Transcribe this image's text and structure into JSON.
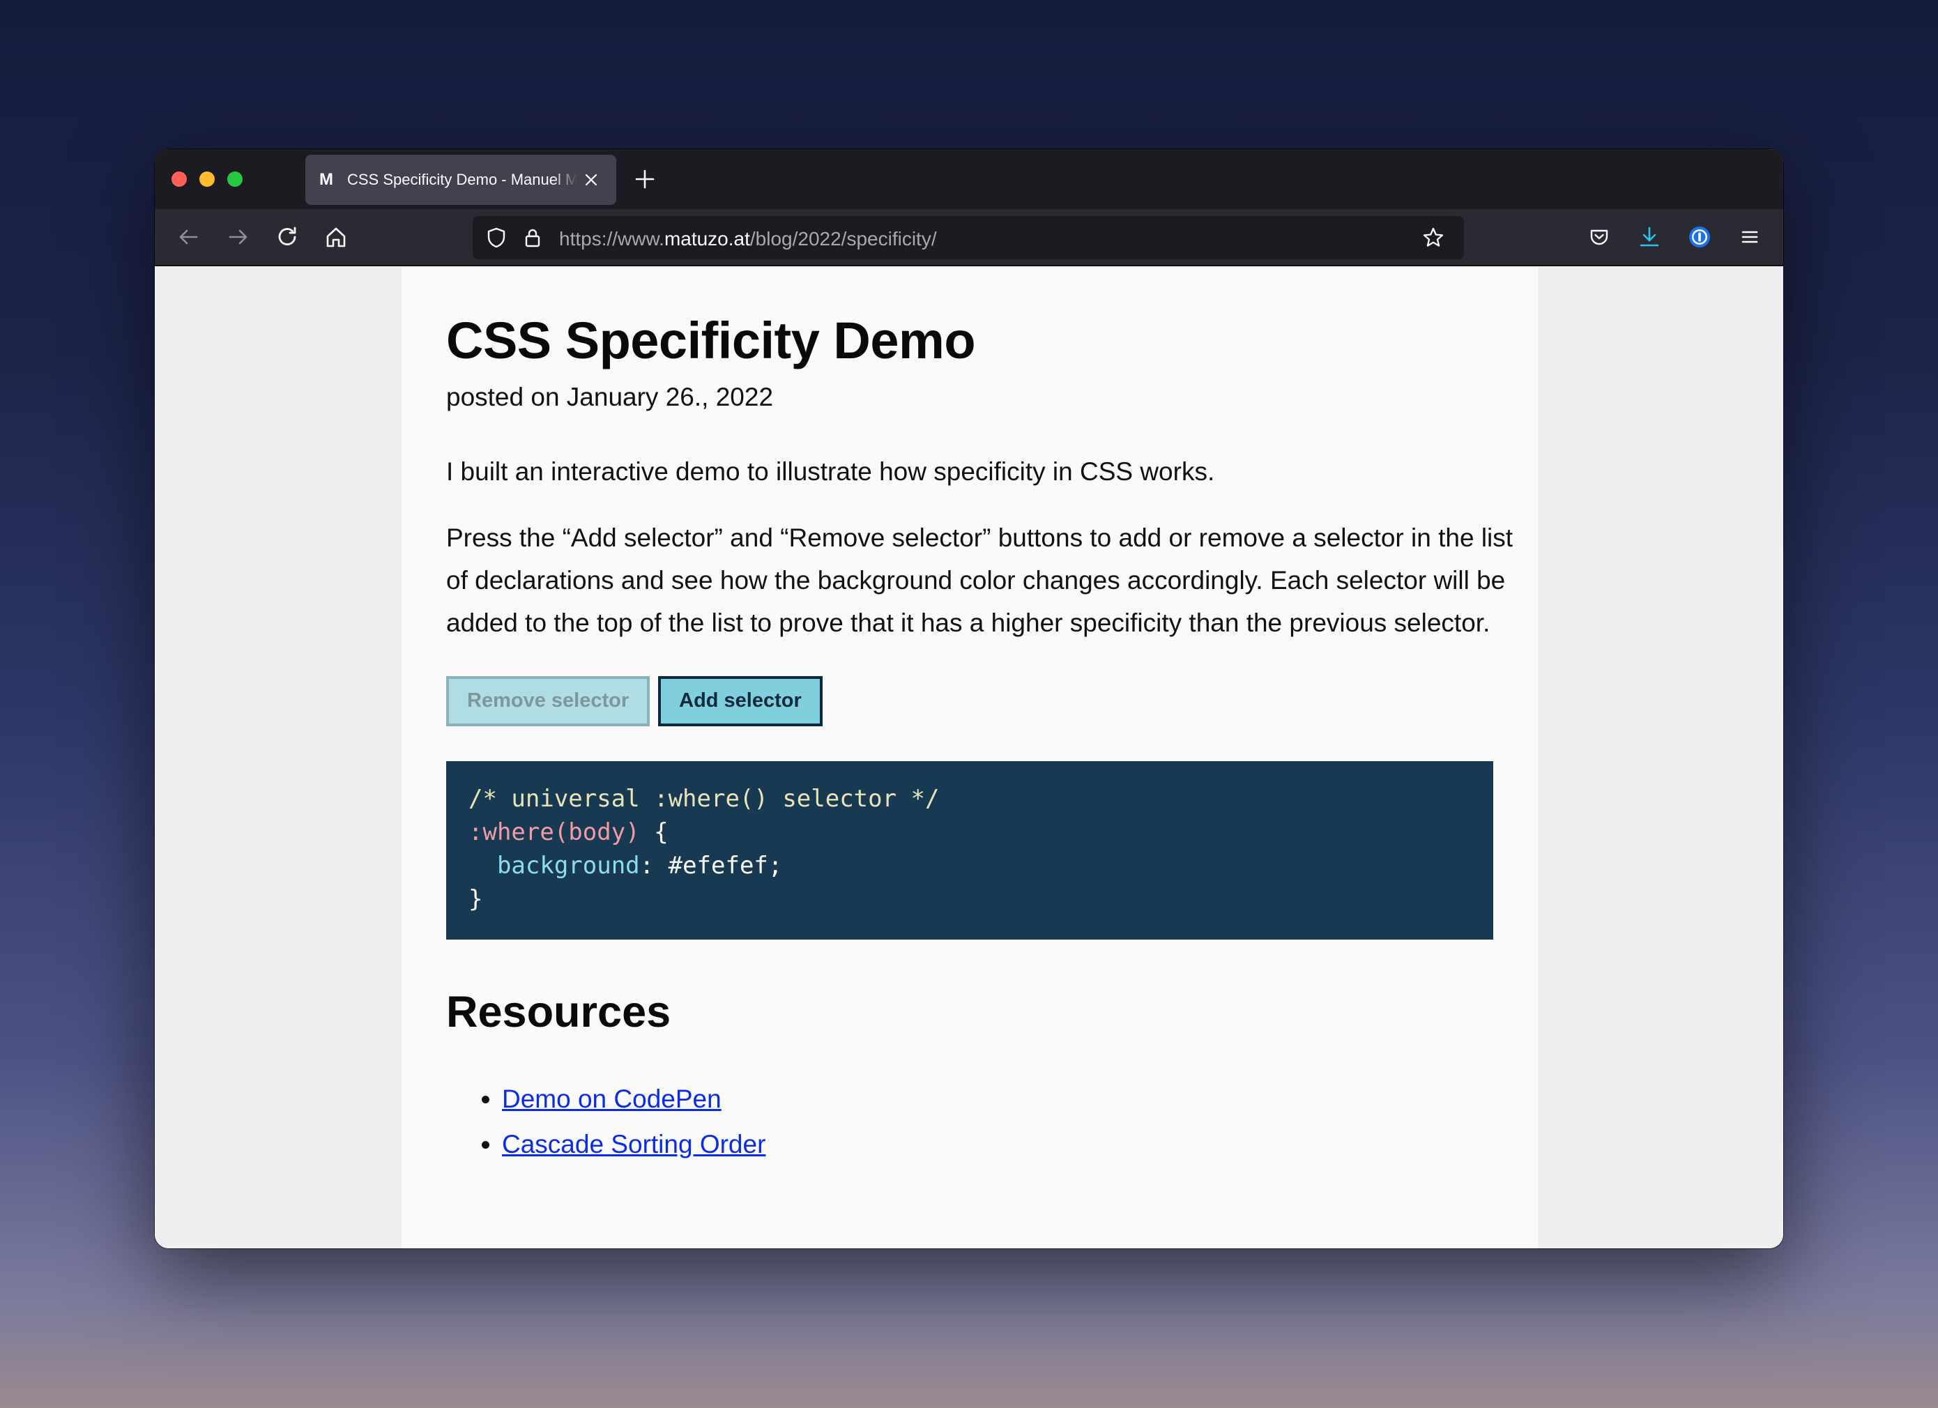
{
  "browser": {
    "tab": {
      "favicon": "M",
      "title": "CSS Specificity Demo - Manuel Matuzovic"
    },
    "url": {
      "prefix": "https://www.",
      "host": "matuzo.at",
      "path": "/blog/2022/specificity/"
    },
    "icons": [
      "back-icon",
      "forward-icon",
      "reload-icon",
      "home-icon",
      "shield-icon",
      "lock-icon",
      "star-icon",
      "pocket-icon",
      "download-icon",
      "password-manager-icon",
      "menu-icon"
    ]
  },
  "article": {
    "title": "CSS Specificity Demo",
    "posted": "posted on January 26., 2022",
    "intro": "I built an interactive demo to illustrate how specificity in CSS works.",
    "paragraph": "Press the “Add selector” and “Remove selector” buttons to add or remove a selector in the list of declarations and see how the background color changes accordingly. Each selector will be added to the top of the list to prove that it has a higher specificity than the previous selector.",
    "buttons": {
      "remove": "Remove selector",
      "add": "Add selector"
    },
    "code": {
      "comment": "/* universal :where() selector */",
      "selector": ":where(body)",
      "open_brace": " {",
      "property": "background",
      "colon": ": ",
      "value": "#efefef;",
      "close_brace": "}"
    },
    "resources_heading": "Resources",
    "links": [
      "Demo on CodePen",
      "Cascade Sorting Order"
    ]
  },
  "colors": {
    "code_bg": "#173a52",
    "add_button_bg": "#7fd0dc",
    "remove_button_bg": "#b0dde4",
    "link": "#0a2ce6"
  }
}
